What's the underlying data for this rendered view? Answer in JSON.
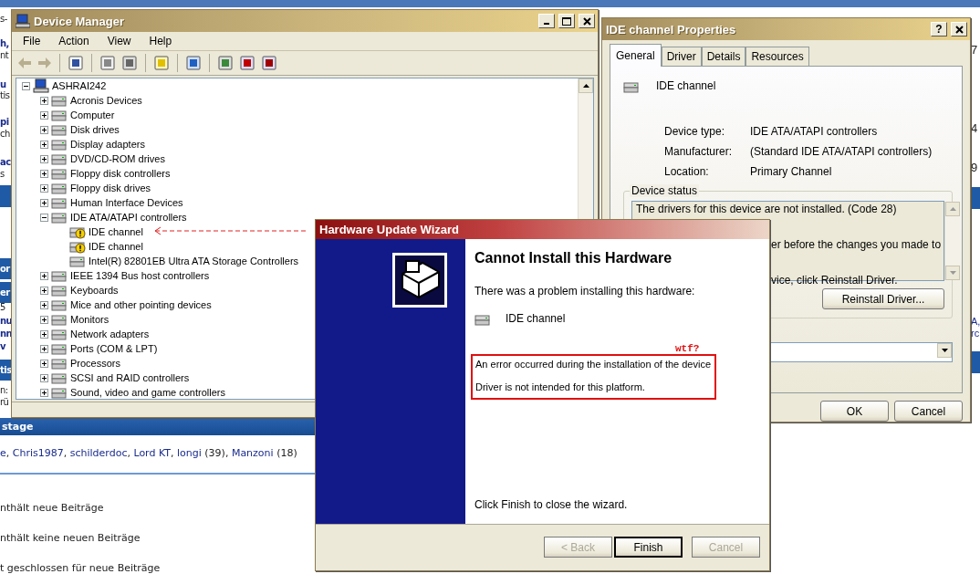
{
  "background_page": {
    "left_fragments": [
      {
        "text": "s-",
        "kind": "plain"
      },
      {
        "text": "h,",
        "kind": "link"
      },
      {
        "text": "nt",
        "kind": "plain"
      },
      {
        "text": "u",
        "kind": "link"
      },
      {
        "text": "tis",
        "kind": "plain"
      },
      {
        "text": "pi",
        "kind": "link"
      },
      {
        "text": "ch",
        "kind": "plain"
      },
      {
        "text": "ac",
        "kind": "link"
      },
      {
        "text": "s",
        "kind": "plain"
      },
      {
        "text": "or",
        "kind": "header"
      },
      {
        "text": "er",
        "kind": "header"
      },
      {
        "text": "5",
        "kind": "plain"
      },
      {
        "text": "nu",
        "kind": "link"
      },
      {
        "text": "nn",
        "kind": "link"
      },
      {
        "text": "v",
        "kind": "link"
      },
      {
        "text": "tis",
        "kind": "header"
      },
      {
        "text": "n:",
        "kind": "plain"
      },
      {
        "text": "rü",
        "kind": "plain"
      }
    ],
    "right_fragments": [
      {
        "text": "7",
        "kind": "plain"
      },
      {
        "text": "4",
        "kind": "plain"
      },
      {
        "text": "9",
        "kind": "plain"
      },
      {
        "text": "A,",
        "kind": "link"
      },
      {
        "text": "rc",
        "kind": "link"
      }
    ],
    "section_header": "stage",
    "online_users": [
      {
        "name": "e",
        "suffix": ","
      },
      {
        "name": "Chris1987",
        "suffix": ","
      },
      {
        "name": "schilderdoc",
        "suffix": ","
      },
      {
        "name": "Lord KT",
        "suffix": ","
      },
      {
        "name": "longi",
        "suffix": " (39),"
      },
      {
        "name": "Manzoni",
        "suffix": " (18)"
      }
    ],
    "legend": [
      "nthält neue Beiträge",
      "nthält keine neuen Beiträge",
      "t geschlossen für neue Beiträge"
    ]
  },
  "device_manager": {
    "title": "Device Manager",
    "menu": [
      "File",
      "Action",
      "View",
      "Help"
    ],
    "tree": {
      "label": "ASHRAI242",
      "expanded": true,
      "children": [
        {
          "label": "Acronis Devices",
          "expanded": false
        },
        {
          "label": "Computer",
          "expanded": false
        },
        {
          "label": "Disk drives",
          "expanded": false
        },
        {
          "label": "Display adapters",
          "expanded": false
        },
        {
          "label": "DVD/CD-ROM drives",
          "expanded": false
        },
        {
          "label": "Floppy disk controllers",
          "expanded": false
        },
        {
          "label": "Floppy disk drives",
          "expanded": false
        },
        {
          "label": "Human Interface Devices",
          "expanded": false
        },
        {
          "label": "IDE ATA/ATAPI controllers",
          "expanded": true,
          "children": [
            {
              "label": "IDE channel",
              "warning": true
            },
            {
              "label": "IDE channel",
              "warning": true
            },
            {
              "label": "Intel(R) 82801EB Ultra ATA Storage Controllers",
              "warning": false
            }
          ]
        },
        {
          "label": "IEEE 1394 Bus host controllers",
          "expanded": false
        },
        {
          "label": "Keyboards",
          "expanded": false
        },
        {
          "label": "Mice and other pointing devices",
          "expanded": false
        },
        {
          "label": "Monitors",
          "expanded": false
        },
        {
          "label": "Network adapters",
          "expanded": false
        },
        {
          "label": "Ports (COM & LPT)",
          "expanded": false
        },
        {
          "label": "Processors",
          "expanded": false
        },
        {
          "label": "SCSI and RAID controllers",
          "expanded": false
        },
        {
          "label": "Sound, video and game controllers",
          "expanded": false
        }
      ]
    }
  },
  "properties": {
    "title": "IDE channel Properties",
    "help_button": "?",
    "tabs": [
      {
        "label": "General",
        "selected": true
      },
      {
        "label": "Driver",
        "selected": false
      },
      {
        "label": "Details",
        "selected": false
      },
      {
        "label": "Resources",
        "selected": false
      }
    ],
    "device_name": "IDE channel",
    "fields": [
      {
        "label": "Device type:",
        "value": "IDE ATA/ATAPI controllers"
      },
      {
        "label": "Manufacturer:",
        "value": "(Standard IDE ATA/ATAPI controllers)"
      },
      {
        "label": "Location:",
        "value": "Primary Channel"
      }
    ],
    "status": {
      "title": "Device status",
      "lines": [
        "The drivers for this device are not installed. (Code 28)",
        "er before the changes you made to",
        "vice, click Reinstall Driver."
      ]
    },
    "reinstall_button": "Reinstall Driver...",
    "buttons": [
      "OK",
      "Cancel"
    ]
  },
  "wizard": {
    "title": "Hardware Update Wizard",
    "heading": "Cannot Install this Hardware",
    "intro": "There was a problem installing this hardware:",
    "device_name": "IDE channel",
    "annotation": "wtf?",
    "errors": [
      "An error occurred during the installation of the device",
      "Driver is not intended for this platform."
    ],
    "footer": "Click Finish to close the wizard.",
    "buttons": [
      {
        "label": "< Back",
        "disabled": true,
        "default": false
      },
      {
        "label": "Finish",
        "disabled": false,
        "default": true
      },
      {
        "label": "Cancel",
        "disabled": true,
        "default": false
      }
    ]
  }
}
